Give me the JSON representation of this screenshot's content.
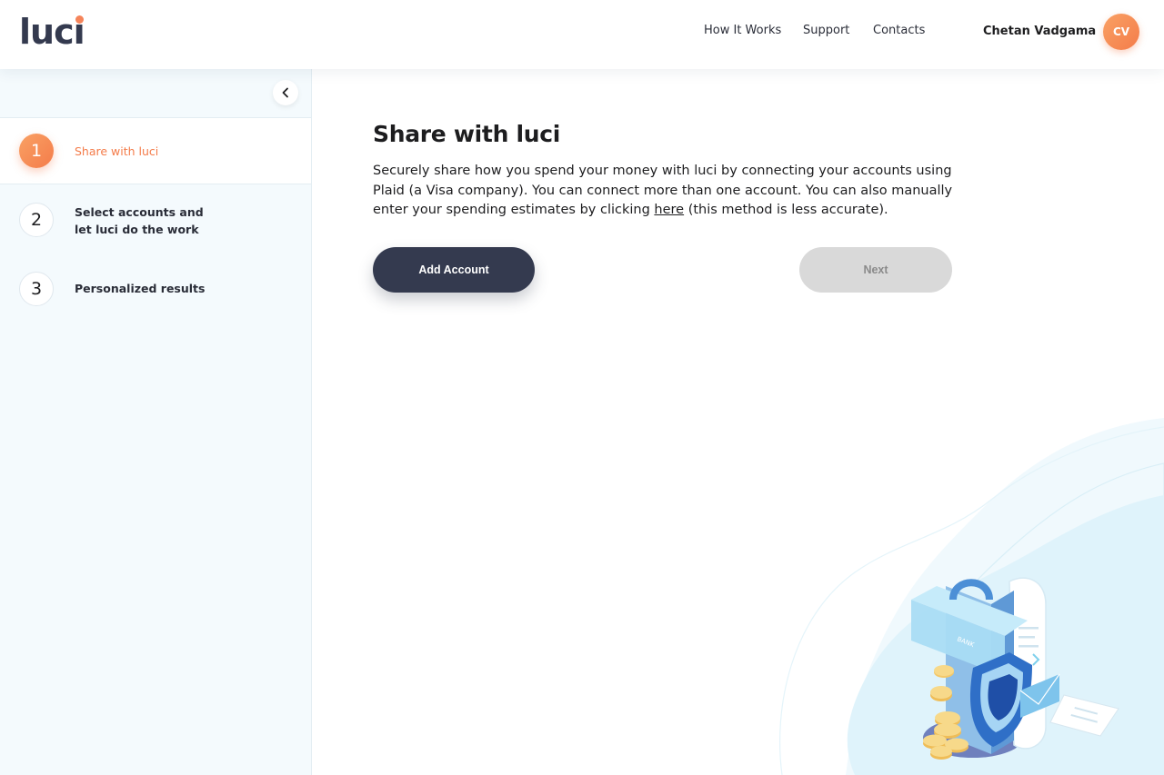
{
  "header": {
    "logo_text": "luc",
    "logo_i": "ı",
    "nav": {
      "how_it_works": "How It Works",
      "support": "Support",
      "contacts": "Contacts"
    },
    "user_name": "Chetan Vadgama",
    "avatar_initials": "CV"
  },
  "sidebar": {
    "collapse_icon": "chevron-left-icon",
    "steps": [
      {
        "number": "1",
        "label": "Share with luci",
        "active": true
      },
      {
        "number": "2",
        "label": "Select accounts and let luci do the work",
        "active": false
      },
      {
        "number": "3",
        "label": "Personalized results",
        "active": false
      }
    ]
  },
  "main": {
    "title": "Share with luci",
    "description_before": "Securely share how you spend your money with luci by connecting your accounts using Plaid (a Visa company). You can connect more than one account. You can also manually enter your spending estimates by clicking ",
    "description_link": "here",
    "description_after": " (this method is less accurate).",
    "add_account_label": "Add Account",
    "next_label": "Next"
  },
  "illustration": {
    "bank_label": "BANK",
    "icon": "secure-bank-illustration"
  },
  "colors": {
    "accent": "#f47c4a",
    "dark": "#343a4f",
    "sidebar_bg": "#f4fafd",
    "disabled_bg": "#d9d9d9"
  }
}
